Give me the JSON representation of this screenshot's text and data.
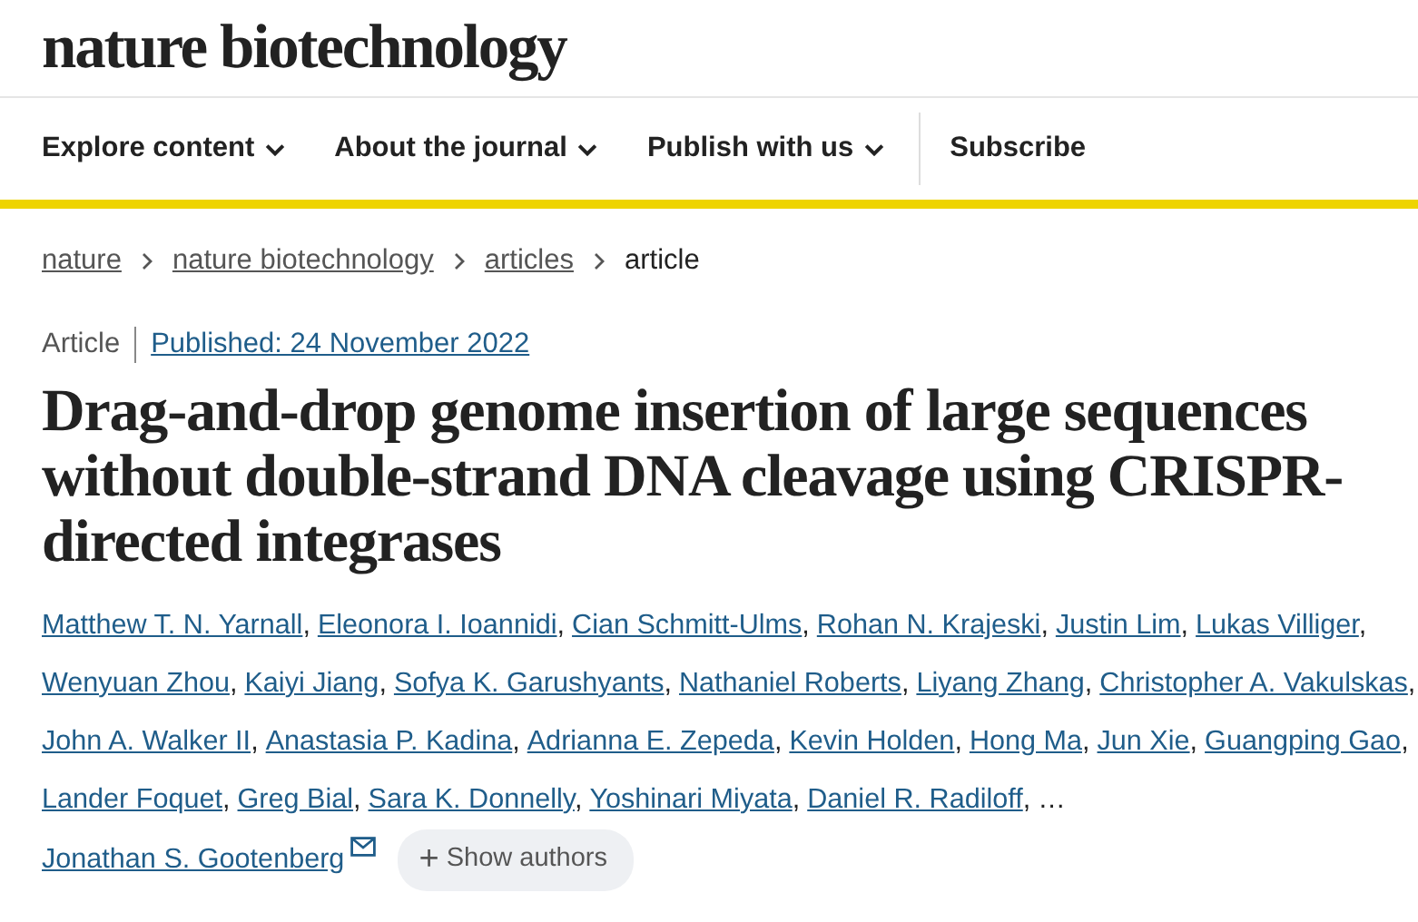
{
  "logo": "nature biotechnology",
  "nav": [
    {
      "label": "Explore content",
      "dropdown": true
    },
    {
      "label": "About the journal",
      "dropdown": true
    },
    {
      "label": "Publish with us",
      "dropdown": true
    },
    {
      "label": "Subscribe",
      "dropdown": false
    }
  ],
  "breadcrumbs": [
    {
      "label": "nature",
      "link": true
    },
    {
      "label": "nature biotechnology",
      "link": true
    },
    {
      "label": "articles",
      "link": true
    },
    {
      "label": "article",
      "link": false
    }
  ],
  "article_type": "Article",
  "published": "Published: 24 November 2022",
  "title": "Drag-and-drop genome insertion of large sequences without double-strand DNA cleavage using CRISPR-directed integrases",
  "authors": [
    "Matthew T. N. Yarnall",
    "Eleonora I. Ioannidi",
    "Cian Schmitt-Ulms",
    "Rohan N. Krajeski",
    "Justin Lim",
    "Lukas Villiger",
    "Wenyuan Zhou",
    "Kaiyi Jiang",
    "Sofya K. Garushyants",
    "Nathaniel Roberts",
    "Liyang Zhang",
    "Christopher A. Vakulskas",
    "John A. Walker II",
    "Anastasia P. Kadina",
    "Adrianna E. Zepeda",
    "Kevin Holden",
    "Hong Ma",
    "Jun Xie",
    "Guangping Gao",
    "Lander Foquet",
    "Greg Bial",
    "Sara K. Donnelly",
    "Yoshinari Miyata",
    "Daniel R. Radiloff"
  ],
  "separator": ",",
  "ellipsis": "…",
  "last_author": {
    "name": "Jonathan S. Gootenberg",
    "email": true
  },
  "show_authors": {
    "icon": "+",
    "label": "Show authors"
  }
}
